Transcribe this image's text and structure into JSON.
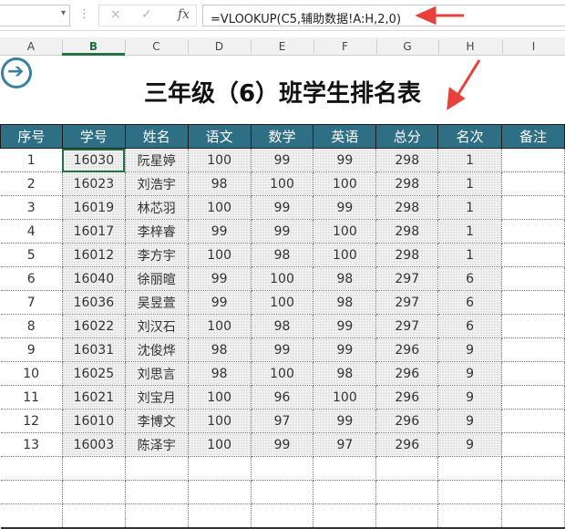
{
  "formula_bar": {
    "name_box": "",
    "formula": "=VLOOKUP(C5,辅助数据!A:H,2,0)",
    "cancel_icon": "×",
    "confirm_icon": "✓",
    "fx_label": "fx",
    "dropdown_icon": "▾",
    "more_icon": "⋮"
  },
  "column_headers": [
    "A",
    "B",
    "C",
    "D",
    "E",
    "F",
    "G",
    "H",
    "I"
  ],
  "sheet": {
    "title": "三年级（6）班学生排名表",
    "nav_icon": "➔",
    "headers": [
      "序号",
      "学号",
      "姓名",
      "语文",
      "数学",
      "英语",
      "总分",
      "名次",
      "备注"
    ],
    "rows": [
      [
        "1",
        "16030",
        "阮星婷",
        "100",
        "99",
        "99",
        "298",
        "1",
        ""
      ],
      [
        "2",
        "16023",
        "刘浩宇",
        "98",
        "100",
        "100",
        "298",
        "1",
        ""
      ],
      [
        "3",
        "16019",
        "林芯羽",
        "100",
        "99",
        "99",
        "298",
        "1",
        ""
      ],
      [
        "4",
        "16017",
        "李梓睿",
        "99",
        "99",
        "100",
        "298",
        "1",
        ""
      ],
      [
        "5",
        "16012",
        "李方宇",
        "100",
        "98",
        "100",
        "298",
        "1",
        ""
      ],
      [
        "6",
        "16040",
        "徐丽暄",
        "99",
        "100",
        "98",
        "297",
        "6",
        ""
      ],
      [
        "7",
        "16036",
        "吴昱萱",
        "99",
        "100",
        "98",
        "297",
        "6",
        ""
      ],
      [
        "8",
        "16022",
        "刘汉石",
        "100",
        "98",
        "99",
        "297",
        "6",
        ""
      ],
      [
        "9",
        "16031",
        "沈俊烨",
        "98",
        "99",
        "99",
        "296",
        "9",
        ""
      ],
      [
        "10",
        "16025",
        "刘思言",
        "98",
        "100",
        "98",
        "296",
        "9",
        ""
      ],
      [
        "11",
        "16021",
        "刘宝月",
        "100",
        "96",
        "100",
        "296",
        "9",
        ""
      ],
      [
        "12",
        "16010",
        "李博文",
        "100",
        "97",
        "99",
        "296",
        "9",
        ""
      ],
      [
        "13",
        "16003",
        "陈泽宇",
        "100",
        "99",
        "97",
        "296",
        "9",
        ""
      ]
    ],
    "empty_rows": 3
  },
  "colors": {
    "header_bg": "#2f6f86",
    "header_text": "#ffffff",
    "annotation_arrow": "#e8413c",
    "excel_green": "#217346"
  }
}
